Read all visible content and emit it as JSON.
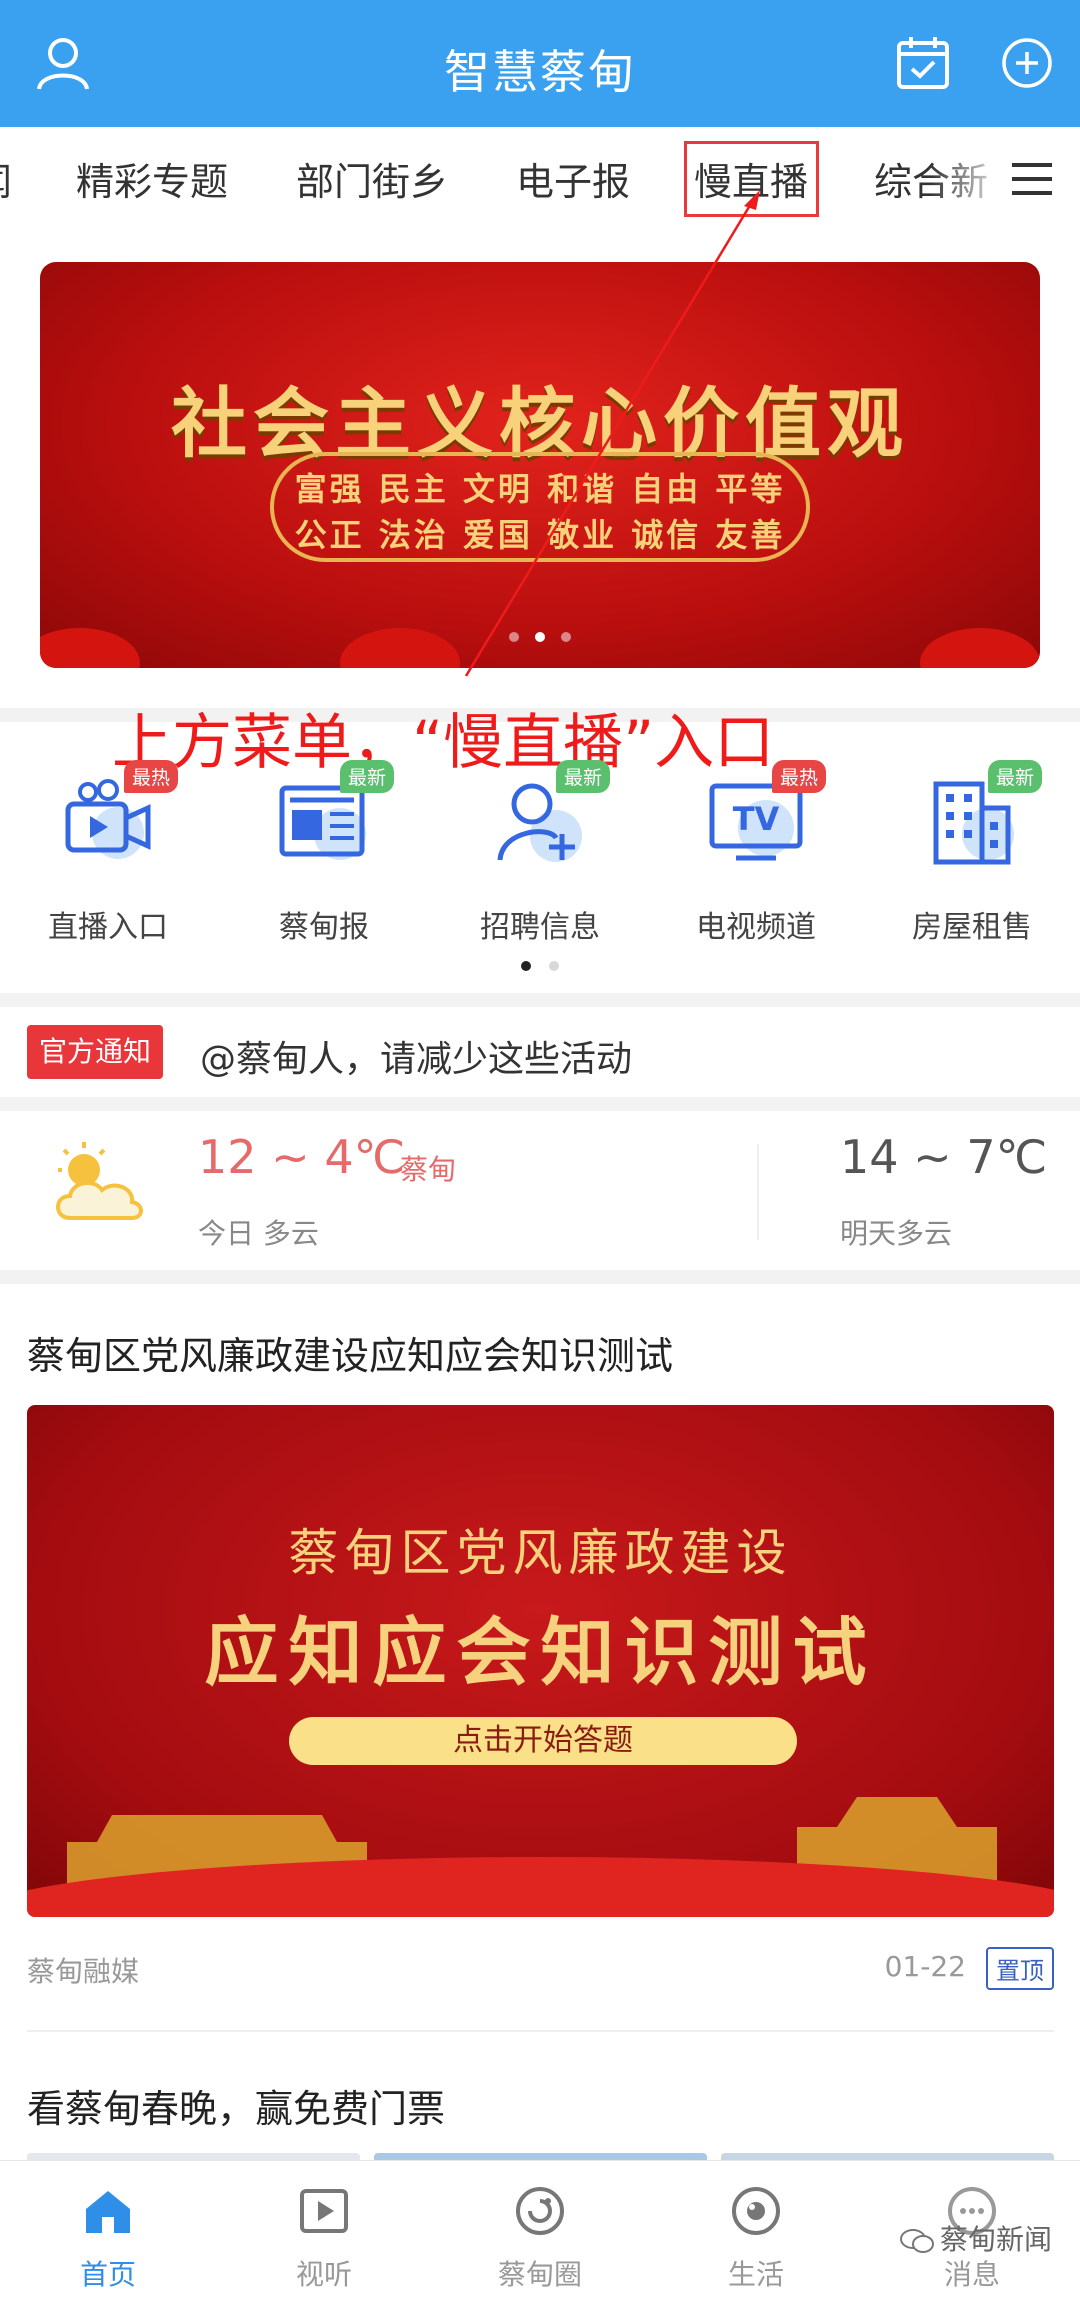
{
  "header": {
    "title": "智慧蔡甸"
  },
  "tabs": [
    {
      "label": "闻"
    },
    {
      "label": "精彩专题"
    },
    {
      "label": "部门街乡"
    },
    {
      "label": "电子报"
    },
    {
      "label": "慢直播"
    },
    {
      "label": "综合新"
    }
  ],
  "annotation": {
    "text": "上方菜单，“慢直播”入口"
  },
  "banner": {
    "main_text": "社会主义核心价值观",
    "line1": "富强 民主 文明 和谐 自由 平等",
    "line2": "公正 法治 爱国 敬业 诚信 友善"
  },
  "shortcuts": [
    {
      "label": "直播入口",
      "badge": "最热",
      "badge_type": "hot",
      "icon": "live-camera-icon"
    },
    {
      "label": "蔡甸报",
      "badge": "最新",
      "badge_type": "new",
      "icon": "newspaper-icon"
    },
    {
      "label": "招聘信息",
      "badge": "最新",
      "badge_type": "new",
      "icon": "recruit-user-icon"
    },
    {
      "label": "电视频道",
      "badge": "最热",
      "badge_type": "hot",
      "icon": "tv-icon"
    },
    {
      "label": "房屋租售",
      "badge": "最新",
      "badge_type": "new",
      "icon": "building-icon"
    }
  ],
  "notice": {
    "tag": "官方通知",
    "text": "@蔡甸人，请减少这些活动"
  },
  "weather": {
    "today_temp": "12 ~ 4℃",
    "city": "蔡甸",
    "today_desc": "今日 多云",
    "tomorrow_temp": "14 ~ 7℃",
    "tomorrow_desc": "明天多云"
  },
  "article1": {
    "title": "蔡甸区党风廉政建设应知应会知识测试",
    "img_line1": "蔡甸区党风廉政建设",
    "img_line2": "应知应会知识测试",
    "img_button": "点击开始答题",
    "source": "蔡甸融媒",
    "date": "01-22",
    "pin": "置顶"
  },
  "article2": {
    "title": "看蔡甸春晚，赢免费门票"
  },
  "tabbar": [
    {
      "label": "首页",
      "icon": "home-icon"
    },
    {
      "label": "视听",
      "icon": "video-play-icon"
    },
    {
      "label": "蔡甸圈",
      "icon": "circle-community-icon"
    },
    {
      "label": "生活",
      "icon": "life-icon"
    },
    {
      "label": "消息",
      "icon": "message-icon"
    }
  ],
  "watermark": "蔡甸新闻",
  "colors": {
    "header": "#3aa0f0",
    "accent_red": "#e8363a",
    "active_tab": "#2f8fe8"
  }
}
